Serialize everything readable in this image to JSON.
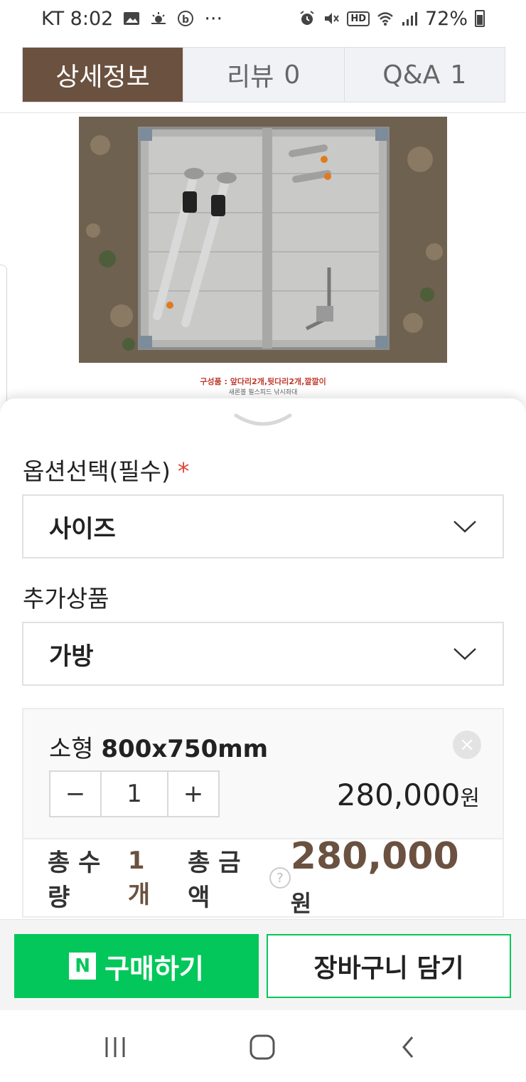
{
  "status_bar": {
    "carrier_time": "KT 8:02",
    "dots": "···",
    "hd": "HD",
    "battery": "72%"
  },
  "tabs": [
    {
      "label": "상세정보",
      "count": ""
    },
    {
      "label": "리뷰",
      "count": "0"
    },
    {
      "label": "Q&A",
      "count": "1"
    }
  ],
  "product_image": {
    "caption_main": "구성품 : 앞다리2개,뒷다리2개,깔깔이",
    "caption_sub": "새론볼 필스피드 낚시좌대"
  },
  "option_section": {
    "label": "옵션선택(필수)",
    "required_mark": "*",
    "select_value": "사이즈"
  },
  "addon_section": {
    "label": "추가상품",
    "select_value": "가방"
  },
  "selected_option": {
    "name_prefix": "소형",
    "name_spec": "800x750mm",
    "minus": "−",
    "quantity": "1",
    "plus": "+",
    "price": "280,000",
    "currency": "원",
    "remove": "×"
  },
  "totals": {
    "qty_label": "총 수량",
    "qty_value": "1개",
    "amount_label": "총 금액",
    "help": "?",
    "amount": "280,000",
    "currency": "원"
  },
  "actions": {
    "npay_badge": "N",
    "buy_label": "구매하기",
    "cart_label": "장바구니 담기"
  },
  "colors": {
    "brand_brown": "#6b5140",
    "naver_green": "#03c75a",
    "required_red": "#e0453a"
  }
}
